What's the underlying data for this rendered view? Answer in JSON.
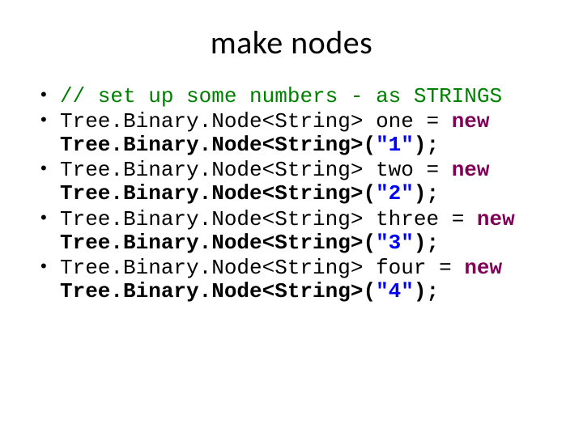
{
  "title": "make nodes",
  "bullets": [
    {
      "comment": "// set up some numbers - as STRINGS"
    },
    {
      "decl_type": "Tree.Binary.Node<String>",
      "var_name": "one",
      "equals": " = ",
      "kw_new": "new",
      "ctor_type": "Tree.Binary.Node<String>",
      "open": "(",
      "literal": "\"1\"",
      "close": ");"
    },
    {
      "decl_type": "Tree.Binary.Node<String>",
      "var_name": "two",
      "equals": " = ",
      "kw_new": "new",
      "ctor_type": "Tree.Binary.Node<String>",
      "open": "(",
      "literal": "\"2\"",
      "close": ");"
    },
    {
      "decl_type": "Tree.Binary.Node<String>",
      "var_name": "three",
      "equals": " = ",
      "kw_new": "new",
      "ctor_type": "Tree.Binary.Node<String>",
      "open": "(",
      "literal": "\"3\"",
      "close": ");"
    },
    {
      "decl_type": "Tree.Binary.Node<String>",
      "var_name": "four",
      "equals": " = ",
      "kw_new": "new",
      "ctor_type": "Tree.Binary.Node<String>",
      "open": "(",
      "literal": "\"4\"",
      "close": ");"
    }
  ]
}
